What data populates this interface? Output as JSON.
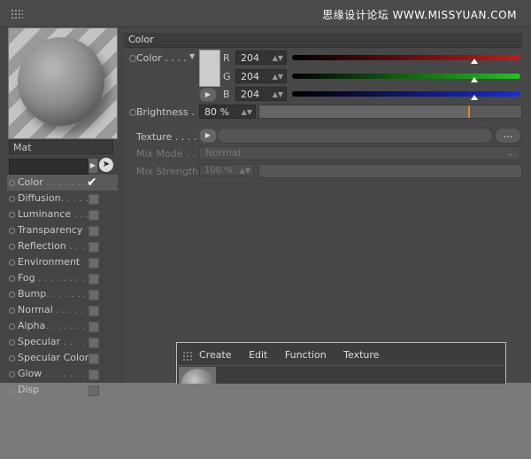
{
  "watermark": "思缘设计论坛 WWW.MISSYUAN.COM",
  "material": {
    "name": "Mat"
  },
  "channels": [
    {
      "label": "Color",
      "dots": " . . . . . . .",
      "enabled": true,
      "active": true
    },
    {
      "label": "Diffusion",
      "dots": ". . . . .",
      "enabled": false
    },
    {
      "label": "Luminance",
      "dots": " . . .",
      "enabled": false
    },
    {
      "label": "Transparency",
      "dots": "",
      "enabled": false
    },
    {
      "label": "Reflection",
      "dots": " . . . .",
      "enabled": false
    },
    {
      "label": "Environment",
      "dots": "",
      "enabled": false
    },
    {
      "label": "Fog",
      "dots": " . . . . . . . . .",
      "enabled": false
    },
    {
      "label": "Bump",
      "dots": ". . . . . . . .",
      "enabled": false
    },
    {
      "label": "Normal",
      "dots": " . . . . .",
      "enabled": false
    },
    {
      "label": "Alpha",
      "dots": ". . . . . . .",
      "enabled": false
    },
    {
      "label": "Specular",
      "dots": " . . . . .",
      "enabled": false
    },
    {
      "label": "Specular Color",
      "dots": "",
      "enabled": false
    },
    {
      "label": "Glow",
      "dots": " . . . . . . . .",
      "enabled": false
    },
    {
      "label": "Disp",
      "dots": "",
      "enabled": false
    }
  ],
  "section": {
    "title": "Color"
  },
  "color": {
    "label": "Color . . . .",
    "swatch": "#cccccc",
    "r_label": "R",
    "g_label": "G",
    "b_label": "B",
    "r": "204",
    "g": "204",
    "b": "204",
    "level_fraction": 0.8
  },
  "brightness": {
    "label": "Brightness",
    "dots": ".",
    "value": "80 %",
    "fraction": 0.8
  },
  "texture": {
    "label": "Texture",
    "dots": ". . . .",
    "more": "..."
  },
  "mix_mode": {
    "label": "Mix Mode",
    "dots": ". .",
    "value": "Normal"
  },
  "mix_strength": {
    "label": "Mix Strength",
    "value": "100 %",
    "fraction": 1.0
  },
  "popup_menu": [
    "Create",
    "Edit",
    "Function",
    "Texture"
  ]
}
